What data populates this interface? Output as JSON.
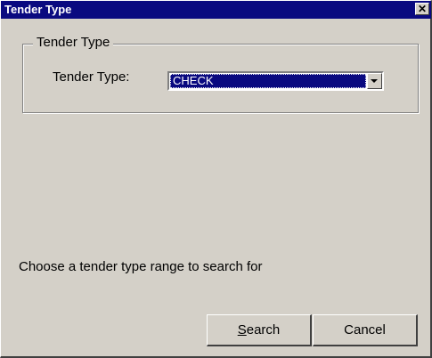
{
  "window": {
    "title": "Tender Type",
    "close_glyph": "✕"
  },
  "group": {
    "legend": "Tender Type",
    "field_label": "Tender Type:",
    "selected_value": "CHECK",
    "arrow_icon": "chevron-down-icon"
  },
  "hint": "Choose a tender type range to search for",
  "buttons": {
    "search_mnemonic": "S",
    "search_rest": "earch",
    "cancel_label": "Cancel"
  },
  "colors": {
    "title_bar": "#0a0a80",
    "dialog_face": "#d4d0c8",
    "selection": "#0a0a80"
  }
}
